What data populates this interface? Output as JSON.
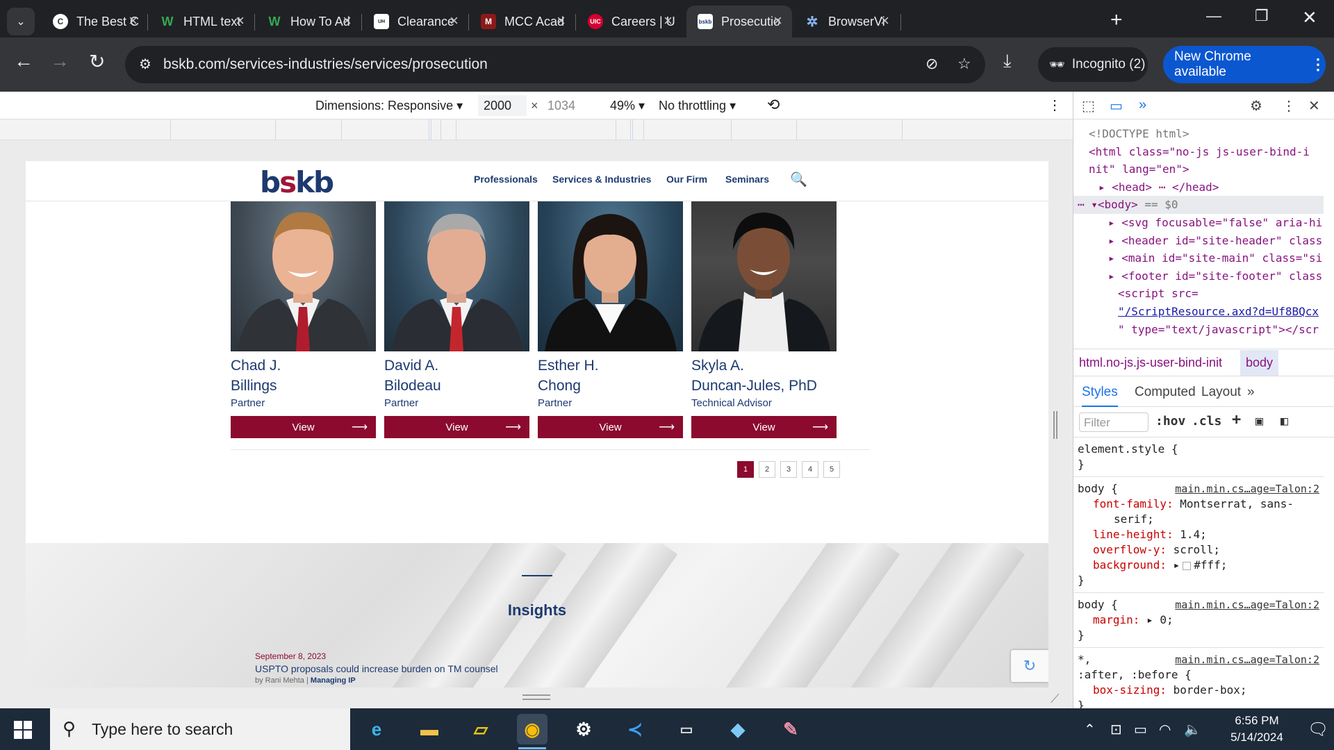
{
  "browser": {
    "tabs": [
      {
        "title": "The Best C",
        "favicon": "C",
        "color": "#ffffff",
        "active": false
      },
      {
        "title": "HTML text",
        "favicon": "W",
        "color": "#2e7d32",
        "active": false
      },
      {
        "title": "How To Ad",
        "favicon": "W",
        "color": "#2e7d32",
        "active": false
      },
      {
        "title": "Clearance",
        "favicon": "UH",
        "color": "#ffffff",
        "active": false
      },
      {
        "title": "MCC Acad",
        "favicon": "M",
        "color": "#8b1a1a",
        "active": false
      },
      {
        "title": "Careers | U",
        "favicon": "UIC",
        "color": "#d50032",
        "active": false
      },
      {
        "title": "Prosecutio",
        "favicon": "bskb",
        "color": "#ffffff",
        "active": true
      },
      {
        "title": "BrowserVi",
        "favicon": "✲",
        "color": "#8ab4f8",
        "active": false
      }
    ],
    "url": "bskb.com/services-industries/services/prosecution",
    "incognito_label": "Incognito (2)",
    "update_label": "New Chrome available"
  },
  "device_toolbar": {
    "dimensions_label": "Dimensions: Responsive",
    "width": "2000",
    "height": "1034",
    "zoom": "49%",
    "throttling": "No throttling"
  },
  "site": {
    "logo_prefix": "b",
    "logo_s": "s",
    "logo_suffix": "kb",
    "nav": [
      "Professionals",
      "Services & Industries",
      "Our Firm",
      "Seminars"
    ],
    "people": [
      {
        "name_line1": "Chad J.",
        "name_line2": "Billings",
        "role": "Partner",
        "button": "View"
      },
      {
        "name_line1": "David A.",
        "name_line2": "Bilodeau",
        "role": "Partner",
        "button": "View"
      },
      {
        "name_line1": "Esther H.",
        "name_line2": "Chong",
        "role": "Partner",
        "button": "View"
      },
      {
        "name_line1": "Skyla A.",
        "name_line2": "Duncan-Jules, PhD",
        "role": "Technical Advisor",
        "button": "View"
      }
    ],
    "pages": [
      "1",
      "2",
      "3",
      "4",
      "5"
    ],
    "current_page": "1",
    "insights": {
      "title": "Insights",
      "date": "September 8, 2023",
      "headline": "USPTO proposals could increase burden on TM counsel",
      "byline_prefix": "by Rani Mehta | ",
      "publication": "Managing IP"
    },
    "colors": {
      "navy": "#1d3a70",
      "maroon": "#8b0a2e"
    }
  },
  "devtools": {
    "dom": {
      "doctype": "<!DOCTYPE html>",
      "html_open": "<html class=\"no-js js-user-bind-i",
      "html_open2": "nit\" lang=\"en\">",
      "head": "<head> ⋯ </head>",
      "body": "<body>",
      "body_eq": "== $0",
      "svg": "<svg focusable=\"false\" aria-hi",
      "header": "<header id=\"site-header\" class",
      "main": "<main id=\"site-main\" class=\"si",
      "footer": "<footer id=\"site-footer\" class",
      "script1": "<script src=",
      "script2": "\"/ScriptResource.axd?d=Uf8BQcx",
      "script3": "\" type=\"text/javascript\"></scr"
    },
    "breadcrumb": {
      "html": "html.no-js.js-user-bind-init",
      "body": "body"
    },
    "tabs": [
      "Styles",
      "Computed",
      "Layout"
    ],
    "filter_placeholder": "Filter",
    "hov": ":hov",
    "cls": ".cls",
    "styles": {
      "element_style": "element.style {",
      "close": "}",
      "body1_sel": "body {",
      "body1_src": "main.min.cs…age=Talon:2",
      "ff_prop": "font-family",
      "ff_val": "Montserrat, sans-",
      "ff_val2": "serif;",
      "lh_prop": "line-height",
      "lh_val": "1.4;",
      "ov_prop": "overflow-y",
      "ov_val": "scroll;",
      "bg_prop": "background",
      "bg_val": "#fff;",
      "body2_sel": "body {",
      "body2_src": "main.min.cs…age=Talon:2",
      "m_prop": "margin",
      "m_val": "0;",
      "star_sel": "*,",
      "star_sel2": ":after, :before {",
      "star_src": "main.min.cs…age=Talon:2",
      "bs_prop": "box-sizing",
      "bs_val": "border-box;"
    }
  },
  "taskbar": {
    "search_placeholder": "Type here to search",
    "time": "6:56 PM",
    "date": "5/14/2024"
  }
}
